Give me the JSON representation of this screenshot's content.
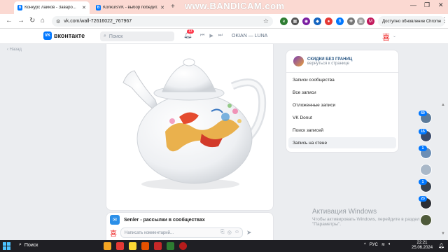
{
  "browser": {
    "tabs": [
      {
        "label": "Конкурс лайков - Заваро..."
      },
      {
        "label": "KonkursVK - выбор победит..."
      }
    ],
    "recorder_watermark": "www.BANDICAM.com",
    "url": "vk.com/wall-72616022_767967",
    "update_button": "Доступно обновление Chrome"
  },
  "vk": {
    "logo_text": "вконтакте",
    "search_placeholder": "Поиск",
    "notifications_count": "13",
    "now_playing": "OKIAN — LUNA",
    "back_label": "Назад"
  },
  "post": {
    "comment_author": "Senler - рассылки в сообществах",
    "comment_placeholder": "Написать комментарий..."
  },
  "right_menu": {
    "community_name": "СКИДКИ БЕЗ ГРАНИЦ",
    "community_sub": "вернуться к странице",
    "items": [
      {
        "label": "Записи сообщества",
        "selected": false
      },
      {
        "label": "Все записи",
        "selected": false
      },
      {
        "label": "Отложенные записи",
        "selected": false
      },
      {
        "label": "VK Donut",
        "selected": false
      },
      {
        "label": "Поиск записей",
        "selected": false
      },
      {
        "label": "Запись на стене",
        "selected": true
      }
    ]
  },
  "side_badges": [
    "60",
    "15",
    "1",
    "1",
    "23"
  ],
  "windows_activation": {
    "title": "Активация Windows",
    "text": "Чтобы активировать Windows, перейдите в раздел \"Параметры\"."
  },
  "taskbar": {
    "search_label": "Поиск",
    "language": "РУС",
    "time": "22:21",
    "date": "25.06.2024"
  }
}
